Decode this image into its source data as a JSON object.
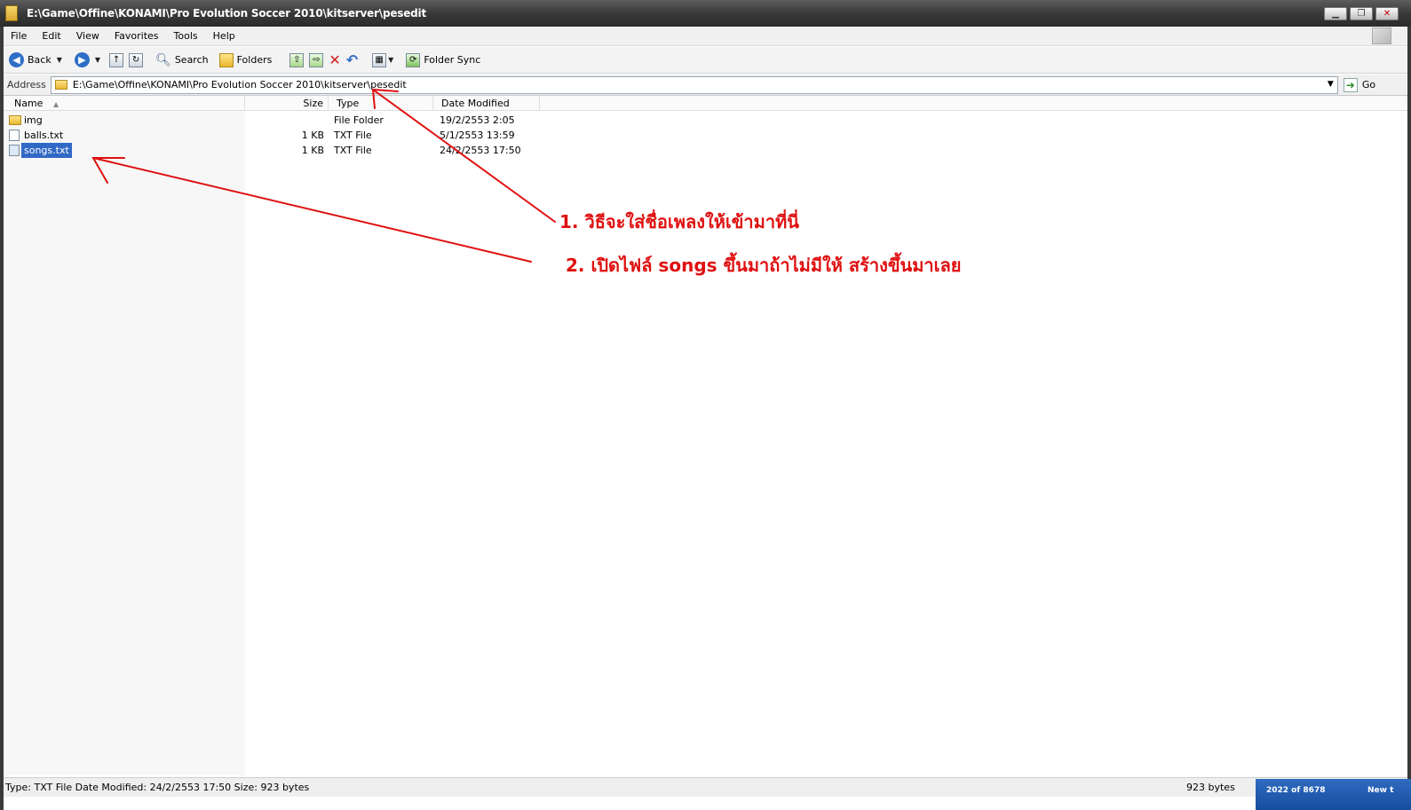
{
  "window": {
    "title": "E:\\Game\\Offine\\KONAMI\\Pro Evolution Soccer 2010\\kitserver\\pesedit",
    "minimize": "▁",
    "maximize": "❐",
    "close": "✕"
  },
  "menu": {
    "items": [
      "File",
      "Edit",
      "View",
      "Favorites",
      "Tools",
      "Help"
    ]
  },
  "toolbar": {
    "back": "Back",
    "search": "Search",
    "folders": "Folders",
    "folder_sync": "Folder Sync"
  },
  "address": {
    "label": "Address",
    "value": "E:\\Game\\Offine\\KONAMI\\Pro Evolution Soccer 2010\\kitserver\\pesedit",
    "go": "Go"
  },
  "columns": {
    "name": "Name",
    "size": "Size",
    "type": "Type",
    "date": "Date Modified"
  },
  "files": [
    {
      "name": "img",
      "size": "",
      "type": "File Folder",
      "date": "19/2/2553 2:05",
      "icon": "folder-icon"
    },
    {
      "name": "balls.txt",
      "size": "1 KB",
      "type": "TXT File",
      "date": "5/1/2553 13:59",
      "icon": "text-file-icon"
    },
    {
      "name": "songs.txt",
      "size": "1 KB",
      "type": "TXT File",
      "date": "24/2/2553 17:50",
      "icon": "text-file-icon",
      "selected": true
    }
  ],
  "status": {
    "details": "Type: TXT File Date Modified: 24/2/2553 17:50 Size: 923 bytes",
    "size": "923 bytes"
  },
  "taskbar": {
    "count": "2022 of 8678",
    "new": "New t"
  },
  "annotations": {
    "note1": "1. วิธีจะใส่ชื่อเพลงให้เข้ามาที่นี่",
    "note2": "2. เปิดไฟล์ songs ขึ้นมาถ้าไม่มีให้ สร้างขึ้นมาเลย",
    "color": "#e01010"
  },
  "colors": {
    "selection": "#3169c6",
    "titlebar": "#3a3a3a"
  }
}
